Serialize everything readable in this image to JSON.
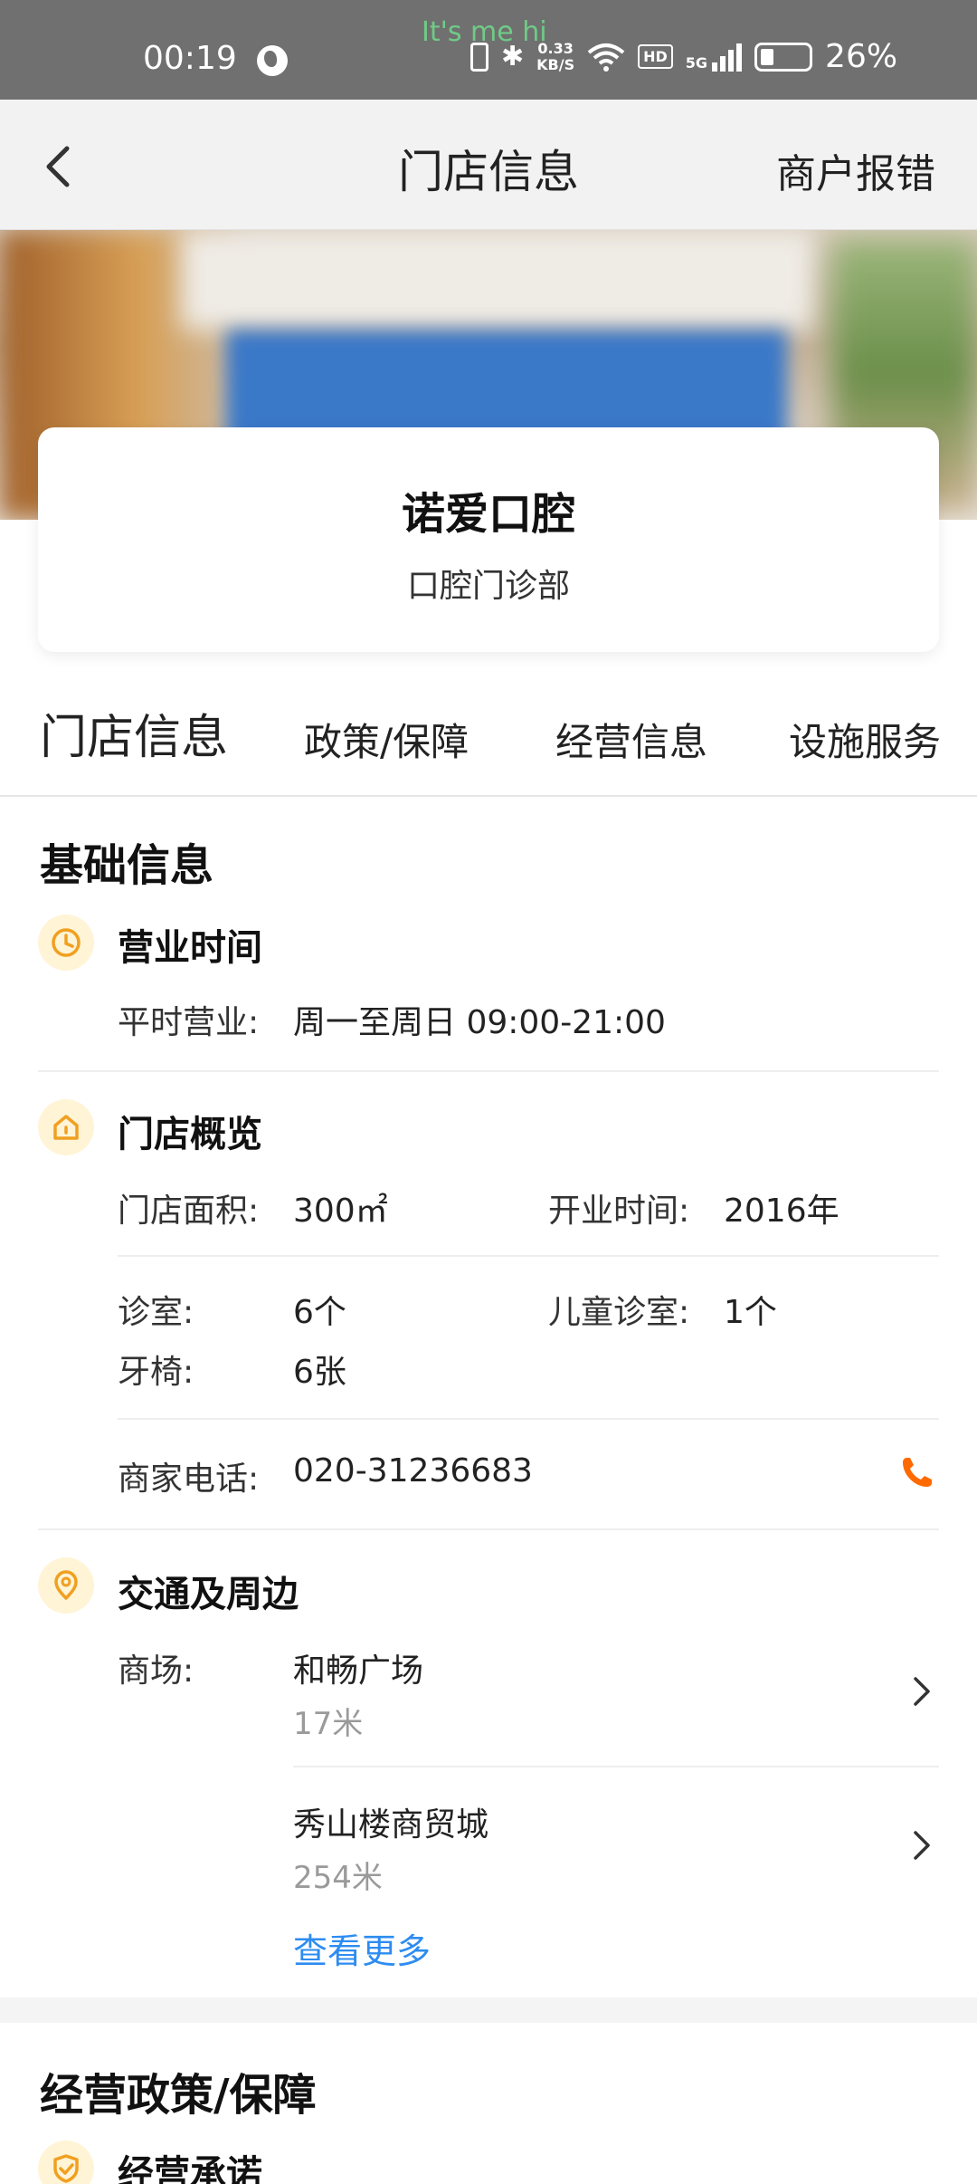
{
  "status_bar": {
    "time": "00:19",
    "overlay_text": "It's me hi",
    "net_speed_value": "0.33",
    "net_speed_unit": "KB/S",
    "hd_label": "HD",
    "signal_label": "5G",
    "battery_percent": "26%",
    "battery_level": 0.26
  },
  "header": {
    "title": "门店信息",
    "action": "商户报错"
  },
  "store": {
    "name": "诺爱口腔",
    "type": "口腔门诊部"
  },
  "tabs": [
    {
      "label": "门店信息",
      "active": true
    },
    {
      "label": "政策/保障",
      "active": false
    },
    {
      "label": "经营信息",
      "active": false
    },
    {
      "label": "设施服务",
      "active": false
    }
  ],
  "basic_info": {
    "title": "基础信息",
    "hours": {
      "title": "营业时间",
      "label": "平时营业:",
      "value": "周一至周日 09:00-21:00"
    },
    "overview": {
      "title": "门店概览",
      "area_label": "门店面积:",
      "area_value": "300㎡",
      "opened_label": "开业时间:",
      "opened_value": "2016年",
      "rooms_label": "诊室:",
      "rooms_value": "6个",
      "kids_rooms_label": "儿童诊室:",
      "kids_rooms_value": "1个",
      "chairs_label": "牙椅:",
      "chairs_value": "6张",
      "phone_label": "商家电话:",
      "phone_value": "020-31236683"
    },
    "traffic": {
      "title": "交通及周边",
      "mall_label": "商场:",
      "malls": [
        {
          "name": "和畅广场",
          "distance": "17米"
        },
        {
          "name": "秀山楼商贸城",
          "distance": "254米"
        }
      ],
      "more": "查看更多"
    }
  },
  "policy": {
    "title": "经营政策/保障",
    "promise_title": "经营承诺"
  },
  "colors": {
    "accent_yellow": "#f5c518",
    "icon_orange": "#f0a020",
    "phone_orange": "#ff6a00",
    "link_blue": "#2d8cf0"
  }
}
